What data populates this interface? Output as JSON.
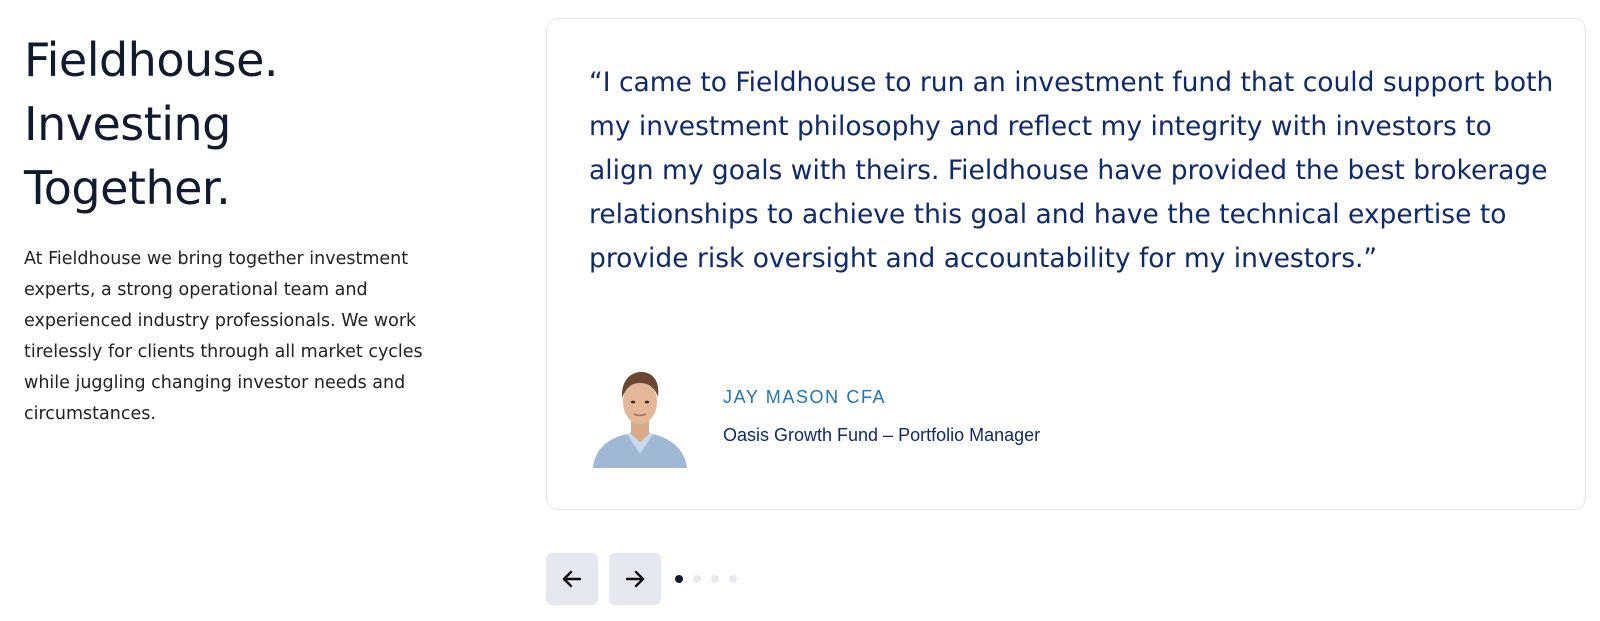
{
  "intro": {
    "headline": [
      "Fieldhouse.",
      "Investing",
      "Together."
    ],
    "text": "At Fieldhouse we bring together investment experts, a strong operational team and experienced industry professionals. We work tirelessly for clients through all market cycles while juggling changing investor needs and circumstances."
  },
  "testimonial": {
    "quote": "“I came to Fieldhouse to run an investment fund that could support both my investment philosophy and reflect my integrity with investors to align my goals with theirs. Fieldhouse have provided the best brokerage relationships to achieve this goal and have the technical expertise to provide risk oversight and accountability for my investors.”",
    "author_name": "JAY MASON CFA",
    "author_title": "Oasis Growth Fund – Portfolio Manager"
  },
  "carousel": {
    "prev_icon": "arrow-left-icon",
    "next_icon": "arrow-right-icon",
    "slide_count": 4,
    "active_index": 0
  },
  "colors": {
    "heading": "#111a2e",
    "quote": "#0f2a6b",
    "author_name": "#1f75b5",
    "button_bg": "#e4e8ef"
  }
}
